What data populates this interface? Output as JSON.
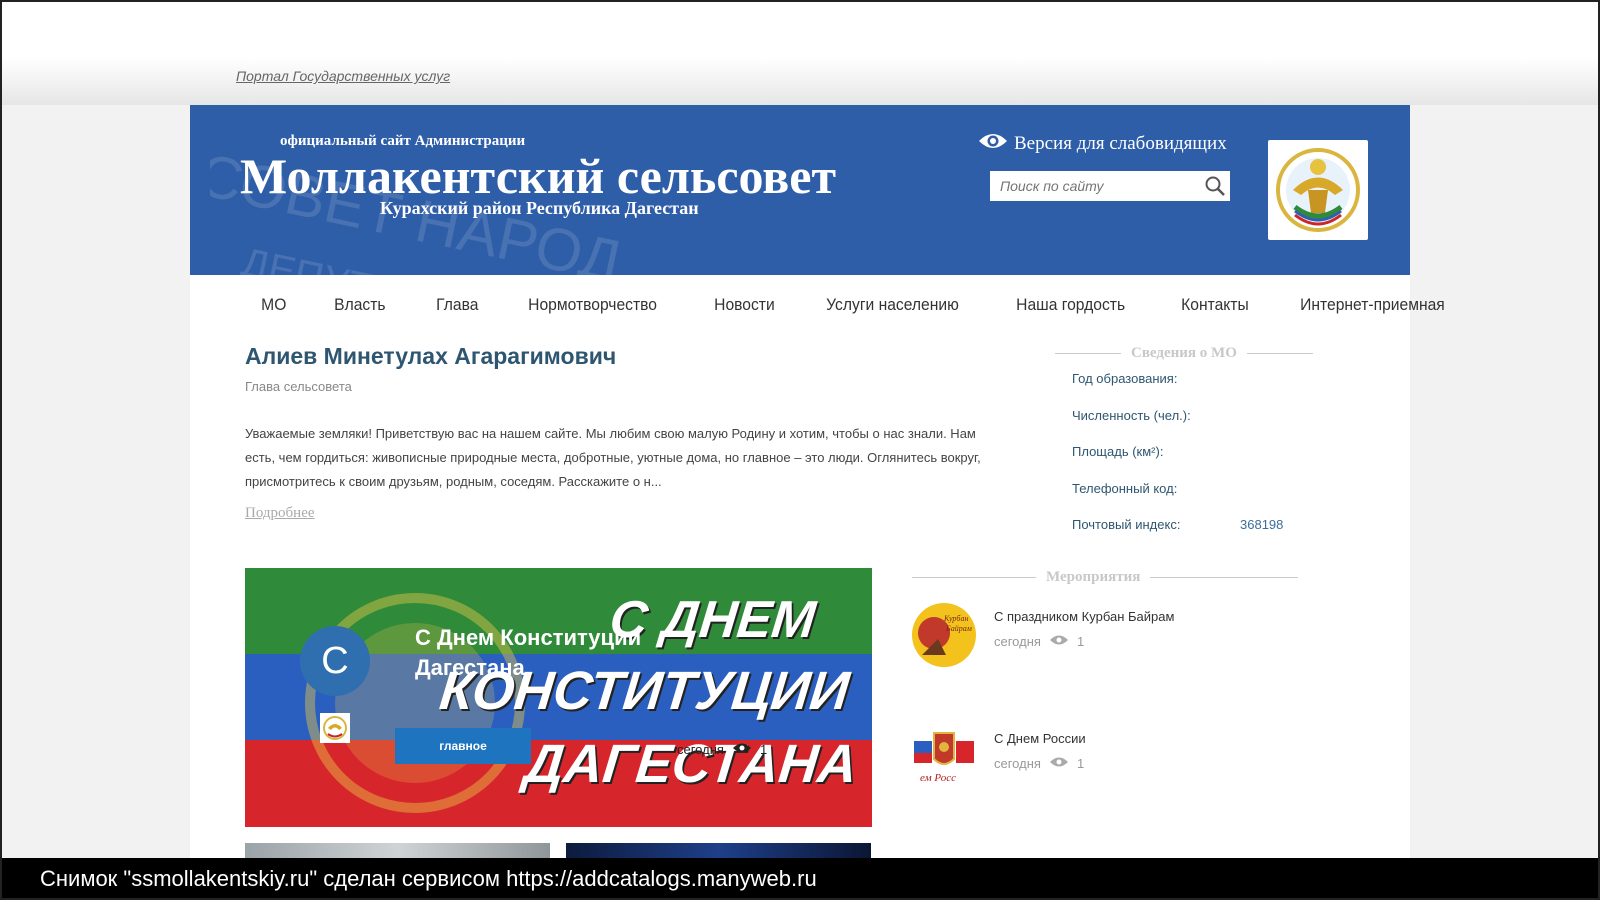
{
  "portal_link": "Портал Государственных услуг",
  "header": {
    "official": "официальный сайт Администрации",
    "title": "Моллакентский сельсовет",
    "region": "Курахский район Республика Дагестан",
    "low_vision": "Версия для слабовидящих",
    "search_placeholder": "Поиск по сайту"
  },
  "nav": [
    "МО",
    "Власть",
    "Глава",
    "Нормотворчество",
    "Новости",
    "Услуги населению",
    "Наша гордость",
    "Контакты",
    "Интернет-приемная"
  ],
  "head": {
    "name": "Алиев Минетулах Агарагимович",
    "role": "Глава сельсовета",
    "text": "Уважаемые земляки! Приветствую вас на нашем сайте.  Мы любим свою малую Родину и хотим, чтобы о нас знали. Нам есть, чем гордиться: живописные природные места, добротные, уютные дома, но главное – это люди. Оглянитесь вокруг, присмотритесь к своим друзьям, родным, соседям. Расскажите о н...",
    "more": "Подробнее"
  },
  "info": {
    "heading": "Сведения о МО",
    "rows": [
      {
        "label": "Год образования:",
        "value": ""
      },
      {
        "label": "Численность (чел.):",
        "value": ""
      },
      {
        "label": "Площадь (км²):",
        "value": ""
      },
      {
        "label": "Телефонный код:",
        "value": ""
      },
      {
        "label": "Почтовый индекс:",
        "value": "368198"
      }
    ]
  },
  "featured": {
    "banner_line1": "С ДНЕМ",
    "banner_line2": "КОНСТИТУЦИИ",
    "banner_line3": "ДАГЕСТАНА",
    "avatar_letter": "С",
    "title": "С Днем Конституции Дагестана",
    "badge": "главное",
    "date": "сегодня",
    "views": "1"
  },
  "events": {
    "heading": "Мероприятия",
    "items": [
      {
        "title": "С праздником Курбан Байрам",
        "date": "сегодня",
        "views": "1",
        "thumb_text": "Курбан Байрам"
      },
      {
        "title": "С Днем России",
        "date": "сегодня",
        "views": "1",
        "thumb_text": "ем Росс"
      }
    ]
  },
  "caption": "Снимок \"ssmollakentskiy.ru\" сделан сервисом https://addcatalogs.manyweb.ru",
  "colors": {
    "header_blue": "#2f5ea8",
    "heading_teal": "#2e5670",
    "badge_blue": "#1f74c0"
  }
}
